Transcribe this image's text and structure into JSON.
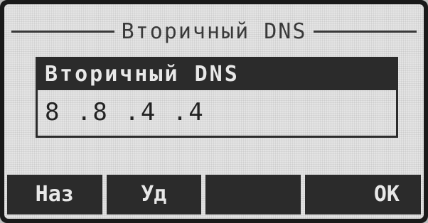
{
  "screen": {
    "title": "Вторичный DNS"
  },
  "field": {
    "label": "Вторичный DNS",
    "value": "8 .8 .4 .4"
  },
  "softkeys": [
    {
      "label": "Наз"
    },
    {
      "label": "Уд"
    },
    {
      "label": ""
    },
    {
      "label": "OK"
    }
  ]
}
